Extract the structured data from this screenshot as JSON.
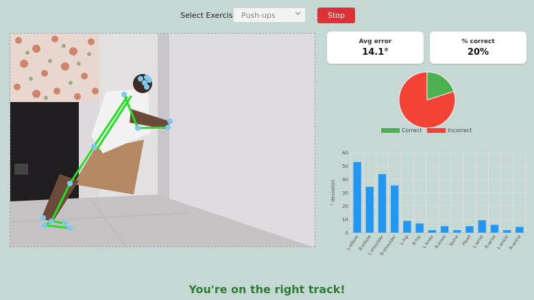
{
  "header": {
    "select_label": "Select Exercise:",
    "exercise_value": "Push-ups",
    "stop_label": "Stop"
  },
  "icons": {
    "dropdown": "chevron-down-icon"
  },
  "colors": {
    "stop_button": "#dd3133",
    "correct": "#4caf50",
    "incorrect": "#f44336",
    "bar": "#2196f3",
    "skeleton_line": "#22e022",
    "skeleton_joint": "#7fc6ef",
    "status_text": "#2e7d32"
  },
  "metrics": {
    "avg_error_label": "Avg error",
    "avg_error_value": "14.1°",
    "pct_correct_label": "% correct",
    "pct_correct_value": "20%"
  },
  "chart_data": [
    {
      "type": "pie",
      "labels": [
        "Correct",
        "Incorrect"
      ],
      "values": [
        20,
        80
      ],
      "colors": [
        "#4caf50",
        "#f44336"
      ],
      "legend": "bottom"
    },
    {
      "type": "bar",
      "ylabel": "° deviation",
      "ylim": [
        0,
        60
      ],
      "yticks": [
        0,
        10,
        20,
        30,
        40,
        50,
        60
      ],
      "grid": true,
      "categories": [
        "L-elbow",
        "R-elbow",
        "L-shoulder",
        "R-shoulder",
        "L-hip",
        "R-hip",
        "L-knee",
        "R-knee",
        "Spine",
        "Head",
        "L-wrist",
        "R-wrist",
        "L-ankle",
        "R-ankle"
      ],
      "values": [
        53,
        34.5,
        44,
        35.5,
        9,
        7,
        2,
        5,
        2,
        5,
        9.5,
        6,
        2,
        4.5
      ]
    }
  ],
  "status_message": "You're on the right track!"
}
